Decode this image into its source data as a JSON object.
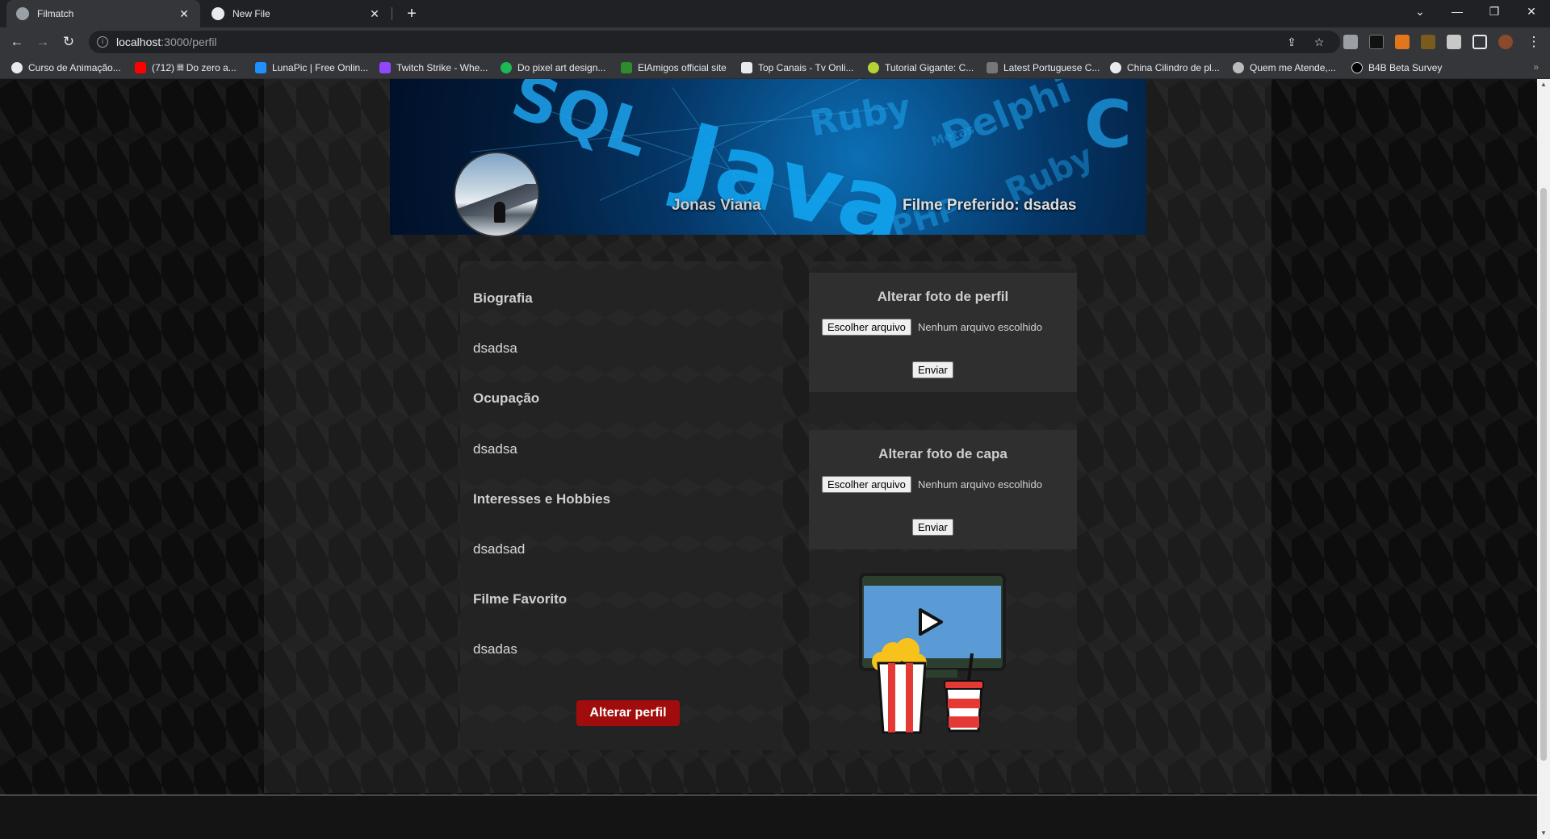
{
  "browser": {
    "tabs": [
      {
        "title": "Filmatch",
        "active": true
      },
      {
        "title": "New File",
        "active": false
      }
    ],
    "url_host": "localhost",
    "url_path": ":3000/perfil",
    "bookmarks": [
      "Curso de Animação...",
      "(712) 𝄜 Do zero a...",
      "LunaPic | Free Onlin...",
      "Twitch Strike - Whe...",
      "Do pixel art design...",
      "ElAmigos official site",
      "Top Canais - Tv Onli...",
      "Tutorial Gigante: C...",
      "Latest Portuguese C...",
      "China Cilindro de pl...",
      "Quem me Atende,...",
      "B4B Beta Survey"
    ],
    "bookmarks_more": "»"
  },
  "cover": {
    "user_name": "Jonas Viana",
    "favorite_label": "Filme Preferido: dsadas",
    "words": [
      "SQL",
      "Java",
      "Ruby",
      "Delphi",
      "C",
      "PHP",
      "Ruby",
      "Metas"
    ]
  },
  "profile": {
    "bio_title": "Biografia",
    "bio_value": "dsadsa",
    "occupation_title": "Ocupação",
    "occupation_value": "dsadsa",
    "interests_title": "Interesses e Hobbies",
    "interests_value": "dsadsad",
    "movie_title": "Filme Favorito",
    "movie_value": "dsadas",
    "edit_button": "Alterar perfil"
  },
  "uploads": {
    "profile_photo": {
      "title": "Alterar foto de perfil",
      "choose_label": "Escolher arquivo",
      "no_file": "Nenhum arquivo escolhido",
      "submit": "Enviar"
    },
    "cover_photo": {
      "title": "Alterar foto de capa",
      "choose_label": "Escolher arquivo",
      "no_file": "Nenhum arquivo escolhido",
      "submit": "Enviar"
    }
  },
  "colors": {
    "accent_button": "#a10d0d",
    "cover_text": "#1ea4ef"
  }
}
